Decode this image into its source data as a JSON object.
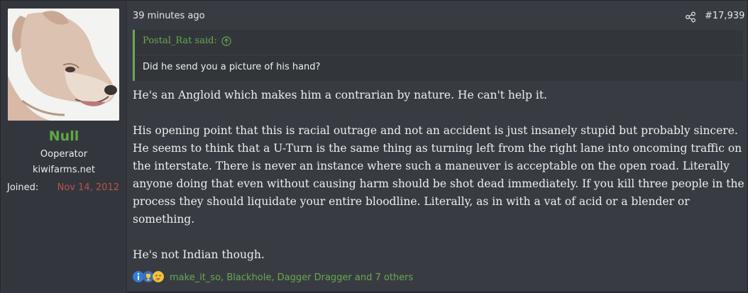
{
  "user": {
    "name": "Null",
    "title": "Ooperator",
    "banner": "kiwifarms.net",
    "joined_label": "Joined:",
    "joined_value": "Nov 14, 2012"
  },
  "post": {
    "time": "39 minutes ago",
    "number": "#17,939",
    "share_icon": "share-icon"
  },
  "quote": {
    "author": "Postal_Rat said:",
    "text": "Did he send you a picture of his hand?"
  },
  "message": {
    "p1": "He's an Angloid which makes him a contrarian by nature. He can't help it.",
    "p2": "His opening point that this is racial outrage and not an accident is just insanely stupid but probably sincere. He seems to think that a U-Turn is the same thing as turning left from the right lane into oncoming traffic on the interstate. There is never an instance where such a maneuver is acceptable on the open road. Literally anyone doing that even without causing harm should be shot dead immediately. If you kill three people in the process they should liquidate your entire bloodline. Literally, as in with a vat of acid or a blender or something.",
    "p3": "He's not Indian though."
  },
  "reactions": {
    "text": "make_it_so, Blackhole, Dagger Dragger and 7 others",
    "icons": [
      "informative-icon",
      "winner-icon",
      "thinking-icon"
    ]
  },
  "colors": {
    "accent_green": "#6aa84f",
    "username_green": "#5fa843",
    "joined_red": "#c0504d",
    "background": "#383c42"
  }
}
